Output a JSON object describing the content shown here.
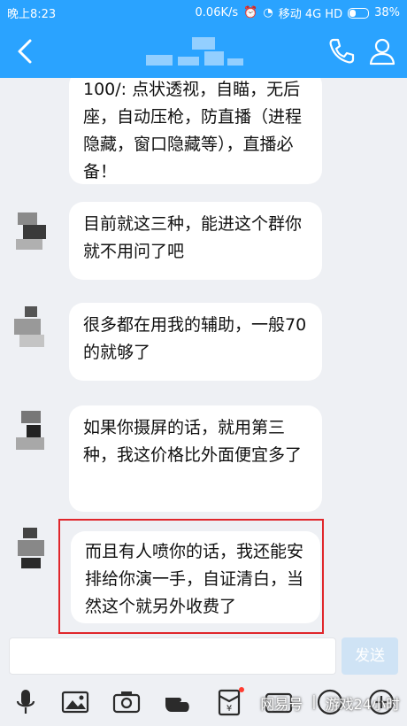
{
  "status_bar": {
    "time": "晚上8:23",
    "speed": "0.06K/s",
    "carrier": "移动 4G HD",
    "battery": "38%"
  },
  "header": {
    "title_blurred": true
  },
  "messages": [
    {
      "text": "100/: 点状透视，自瞄，无后座，自动压枪，防直播（进程隐藏，窗口隐藏等），直播必备！",
      "sender": "other"
    },
    {
      "text": "目前就这三种，能进这个群你就不用问了吧",
      "sender": "other"
    },
    {
      "text": "很多都在用我的辅助，一般70的就够了",
      "sender": "other"
    },
    {
      "text": "如果你摄屏的话，就用第三种，我这价格比外面便宜多了",
      "sender": "other"
    },
    {
      "text": "而且有人喷你的话，我还能安排给你演一手，自证清白，当然这个就另外收费了",
      "sender": "other",
      "highlighted": true
    }
  ],
  "input": {
    "placeholder": "",
    "send_label": "发送"
  },
  "toolbar": {
    "icons": [
      "microphone-icon",
      "image-icon",
      "camera-icon",
      "gesture-icon",
      "red-packet-icon",
      "sticker-icon",
      "emoji-icon",
      "plus-icon"
    ]
  },
  "watermark": {
    "left": "网易号",
    "right": "游戏24小时"
  },
  "colors": {
    "header": "#2aa3ff",
    "highlight": "#e0262b",
    "background": "#eef0f4"
  }
}
